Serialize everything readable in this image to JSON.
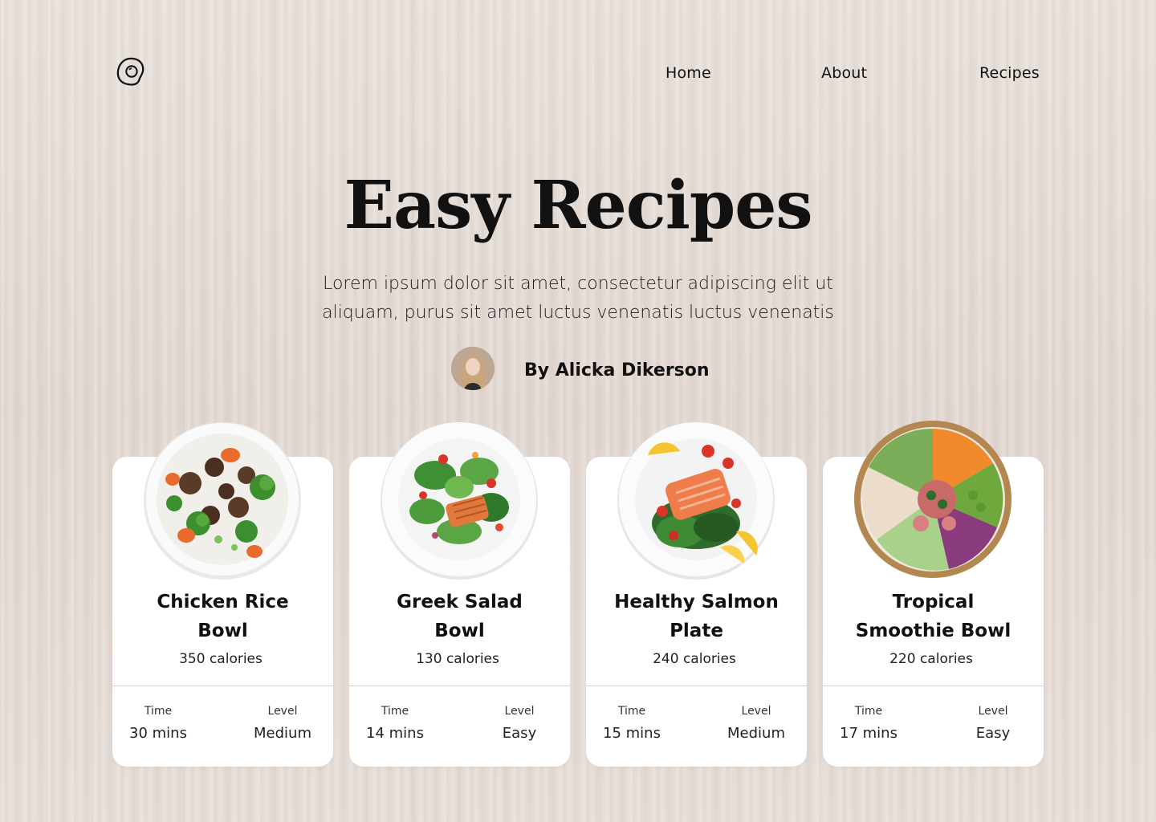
{
  "nav": {
    "logo_icon": "egg-logo-icon",
    "links": [
      "Home",
      "About",
      "Recipes"
    ]
  },
  "hero": {
    "title": "Easy Recipes",
    "description": "Lorem ipsum dolor sit amet, consectetur adipiscing elit ut aliquam, purus sit amet luctus venenatis luctus venenatis",
    "author": "By Alicka Dikerson"
  },
  "meta_labels": {
    "time": "Time",
    "level": "Level"
  },
  "recipes": [
    {
      "name": "Chicken Rice Bowl",
      "calories": "350 calories",
      "time": "30 mins",
      "level": "Medium",
      "image": "chicken-rice-bowl-image"
    },
    {
      "name": "Greek Salad Bowl",
      "calories": "130 calories",
      "time": "14 mins",
      "level": "Easy",
      "image": "greek-salad-image"
    },
    {
      "name": "Healthy Salmon Plate",
      "calories": "240 calories",
      "time": "15 mins",
      "level": "Medium",
      "image": "salmon-plate-image"
    },
    {
      "name": "Tropical Smoothie Bowl",
      "calories": "220 calories",
      "time": "17 mins",
      "level": "Easy",
      "image": "poke-bowl-image"
    }
  ]
}
